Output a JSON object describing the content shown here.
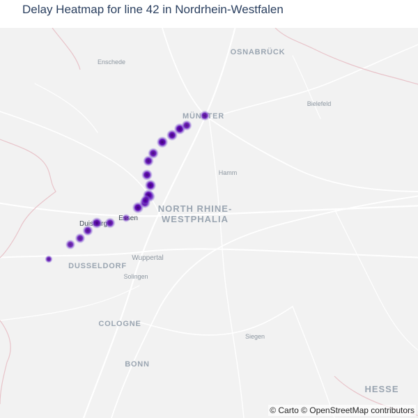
{
  "title": "Delay Heatmap for line 42 in Nordrhein-Westfalen",
  "attribution": "© Carto © OpenStreetMap contributors",
  "colors": {
    "land": "#f2f2f2",
    "road": "#ffffff",
    "minor_road": "#fbfbfb",
    "border": "#e8c3c9",
    "label_major": "#9aa5b1",
    "label_minor": "#8c96a0",
    "heat_core": "#3b0072",
    "heat_mid": "#5a00b5",
    "heat_edge": "#8e72d6"
  },
  "labels": [
    {
      "text": "OSNABRÜCK",
      "kind": "city"
    },
    {
      "text": "Enschede",
      "kind": "town"
    },
    {
      "text": "Bielefeld",
      "kind": "town"
    },
    {
      "text": "MÜNSTER",
      "kind": "city"
    },
    {
      "text": "Hamm",
      "kind": "town"
    },
    {
      "text": "NORTH RHINE-",
      "kind": "region"
    },
    {
      "text": "WESTPHALIA",
      "kind": "region"
    },
    {
      "text": "Duisburg",
      "kind": "town"
    },
    {
      "text": "Essen",
      "kind": "town"
    },
    {
      "text": "Wuppertal",
      "kind": "town"
    },
    {
      "text": "DUSSELDORF",
      "kind": "city"
    },
    {
      "text": "Solingen",
      "kind": "town"
    },
    {
      "text": "COLOGNE",
      "kind": "city"
    },
    {
      "text": "Siegen",
      "kind": "town"
    },
    {
      "text": "BONN",
      "kind": "city"
    },
    {
      "text": "HESSE",
      "kind": "region"
    }
  ],
  "heat_points": [
    {
      "intensity": 0.35
    },
    {
      "intensity": 0.75
    },
    {
      "intensity": 0.8
    },
    {
      "intensity": 0.85
    },
    {
      "intensity": 0.95
    },
    {
      "intensity": 0.85
    },
    {
      "intensity": 1.0
    },
    {
      "intensity": 0.95
    },
    {
      "intensity": 0.9
    },
    {
      "intensity": 0.95
    },
    {
      "intensity": 1.0
    },
    {
      "intensity": 0.95
    },
    {
      "intensity": 0.9
    },
    {
      "intensity": 0.9
    },
    {
      "intensity": 1.0
    },
    {
      "intensity": 0.5
    },
    {
      "intensity": 0.95
    },
    {
      "intensity": 1.0
    },
    {
      "intensity": 0.85
    },
    {
      "intensity": 0.8
    },
    {
      "intensity": 0.75
    },
    {
      "intensity": 0.35
    }
  ]
}
